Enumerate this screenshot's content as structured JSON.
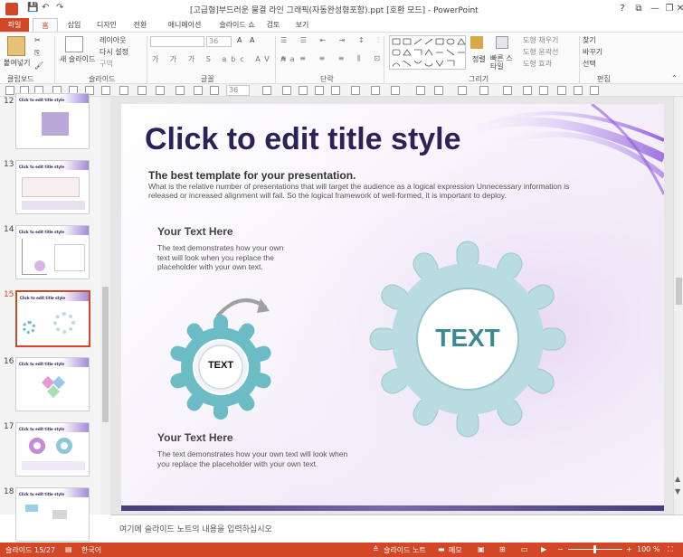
{
  "window": {
    "title": "[고급형]부드러운 물결 라인 그래픽(자동완성형포함).ppt [호환 모드] - PowerPoint",
    "controls": [
      "?",
      "⧉",
      "—",
      "❐",
      "✕"
    ]
  },
  "tabs": [
    "파일",
    "홈",
    "삽입",
    "디자인",
    "전환",
    "애니메이션",
    "슬라이드 쇼",
    "검토",
    "보기"
  ],
  "ribbon": {
    "clipboard": {
      "paste": "붙여넣기",
      "label": "클립보드"
    },
    "slides": {
      "new_slide": "새 슬라이드",
      "layout": "레이아웃",
      "reset": "다시 설정",
      "section": "구역",
      "label": "슬라이드"
    },
    "font": {
      "size": "36",
      "label": "글꼴"
    },
    "paragraph": {
      "label": "단락"
    },
    "drawing": {
      "arrange": "정렬",
      "quick_styles": "빠른 스타일",
      "fill": "도형 채우기",
      "outline": "도형 윤곽선",
      "effects": "도형 효과",
      "label": "그리기"
    },
    "editing": {
      "find": "찾기",
      "replace": "바꾸기",
      "select": "선택",
      "label": "편집"
    }
  },
  "toolbar2": {
    "font_size": "36"
  },
  "slide_panel": {
    "thumbs": [
      {
        "num": "12",
        "title": "Click to edit title style"
      },
      {
        "num": "13",
        "title": "Click to edit title style"
      },
      {
        "num": "14",
        "title": "Click to edit title style"
      },
      {
        "num": "15",
        "title": "Click to edit title style",
        "selected": true
      },
      {
        "num": "16",
        "title": "Click to edit title style"
      },
      {
        "num": "17",
        "title": "Click to edit title style"
      },
      {
        "num": "18",
        "title": "Click to edit title style"
      }
    ]
  },
  "slide": {
    "title": "Click to edit title style",
    "subtitle": "The best template for your presentation.",
    "body": "What is the relative number of presentations that will target the audience as a logical expression Unnecessary information is released or increased alignment will fail. So the logical framework of well-formed, it is important to deploy.",
    "block1": {
      "heading": "Your Text Here",
      "text": "The text demonstrates how your own text will look when you replace the placeholder with your own text."
    },
    "block2": {
      "heading": "Your Text Here",
      "text": "The text demonstrates how your own text will look when you replace the placeholder with your own text."
    },
    "small_gear_label": "TEXT",
    "large_gear_label": "TEXT",
    "colors": {
      "title": "#2c2259",
      "gear": "#b9dce0",
      "gear_dark": "#6bbcc4",
      "gear_text": "#3a8a94"
    }
  },
  "notes": {
    "placeholder": "여기에 슬라이드 노트의 내용을 입력하십시오"
  },
  "status": {
    "slide_pos": "슬라이드 15/27",
    "language": "한국어",
    "notes_btn": "슬라이드 노트",
    "comments_btn": "메모",
    "zoom": "100 %"
  }
}
